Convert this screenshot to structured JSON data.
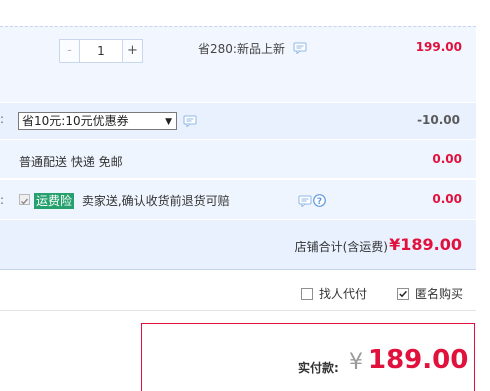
{
  "item": {
    "qty_minus": "-",
    "qty_value": "1",
    "qty_plus": "+",
    "promo": "省280:新品上新",
    "price": "199.00"
  },
  "coupon": {
    "selected": "省10元:10元优惠券",
    "amount": "-10.00"
  },
  "shipping": {
    "method": "普通配送 快递 免邮",
    "amount": "0.00"
  },
  "insurance": {
    "badge": "运费险",
    "text": "卖家送,确认收货前退货可赔",
    "amount": "0.00"
  },
  "total": {
    "label": "店铺合计(含运费)",
    "amount": "¥189.00"
  },
  "options": {
    "proxy_pay_label": "找人代付",
    "proxy_pay_checked": false,
    "anonymous_label": "匿名购买",
    "anonymous_checked": true
  },
  "payment": {
    "label": "实付款:",
    "currency": "¥",
    "amount": "189.00"
  },
  "colors": {
    "accent_red": "#e0113c",
    "row_bg": "#eff5ff",
    "badge_green": "#26a06d",
    "icon_blue": "#8fb7e6"
  },
  "icons": [
    "chat-icon",
    "help-icon",
    "chevron-down-icon",
    "checkmark-icon"
  ]
}
